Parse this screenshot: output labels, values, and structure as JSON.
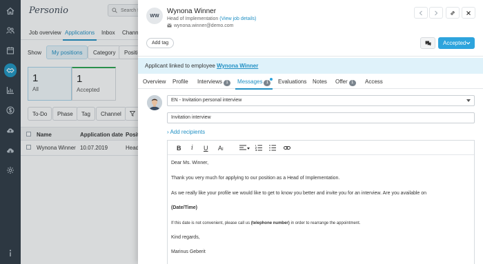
{
  "nav": {
    "icons": [
      "home-icon",
      "people-icon",
      "calendar-icon",
      "recruiting-icon",
      "chart-icon",
      "dollar-icon",
      "cloud-upload-icon",
      "cloud-download-icon",
      "settings-icon",
      "info-icon"
    ],
    "active": "recruiting-icon"
  },
  "bg": {
    "logo": "Personio",
    "search_placeholder": "Search f",
    "tabs": [
      "Job overview",
      "Applications",
      "Inbox",
      "Channe"
    ],
    "active_tab": "Applications",
    "show_label": "Show",
    "show_pills": [
      "My positions",
      "Category",
      "Positio"
    ],
    "cards": [
      {
        "count": "1",
        "label": "All"
      },
      {
        "count": "1",
        "label": "Accepted"
      }
    ],
    "filters": [
      "To-Do",
      "Phase",
      "Tag",
      "Channel"
    ],
    "table_headers": [
      "Name",
      "Application date",
      "Positio"
    ],
    "rows": [
      {
        "name": "Wynona Winner",
        "date": "10.07.2019",
        "position": "Head"
      }
    ]
  },
  "candidate": {
    "initials": "WW",
    "name": "Wynona Winner",
    "role": "Head of Implementation",
    "view_job": "(View job details)",
    "email": "wynona.winner@demo.com",
    "add_tag": "Add tag",
    "status": "Accepted"
  },
  "banner": {
    "prefix": "Applicant linked to employee",
    "employee": "Wynona Winner"
  },
  "tabs": [
    {
      "label": "Overview"
    },
    {
      "label": "Profile"
    },
    {
      "label": "Interviews",
      "badge": "1"
    },
    {
      "label": "Messages",
      "badge": "1"
    },
    {
      "label": "Evaluations"
    },
    {
      "label": "Notes"
    },
    {
      "label": "Offer",
      "badge": "1"
    },
    {
      "label": "Access"
    }
  ],
  "active_tab": "Messages",
  "message": {
    "template": "EN - Invitation personal interview",
    "subject": "Invitation interview",
    "add_recipients": "Add recipients",
    "greeting": "Dear Ms. Winner,",
    "p1": "Thank you very much for applying to our position as a Head of Implementation.",
    "p2": "As we really like your profile we would like to get to know you better and invite you for an interview. Are you available on",
    "date_placeholder": "(Date/Time)",
    "p3_pre": "If this date is not convenient, please call us",
    "p3_bold": "(telephone number)",
    "p3_post": "in order to rearrange the appointment.",
    "closing": "Kind regards,",
    "signature": "Marinus Geberit"
  },
  "colors": {
    "accent": "#2190c4",
    "button": "#2ea4dd",
    "nav_bg": "#2f3a45",
    "banner_bg": "#dff2fa",
    "accepted_green": "#2aa44f"
  }
}
